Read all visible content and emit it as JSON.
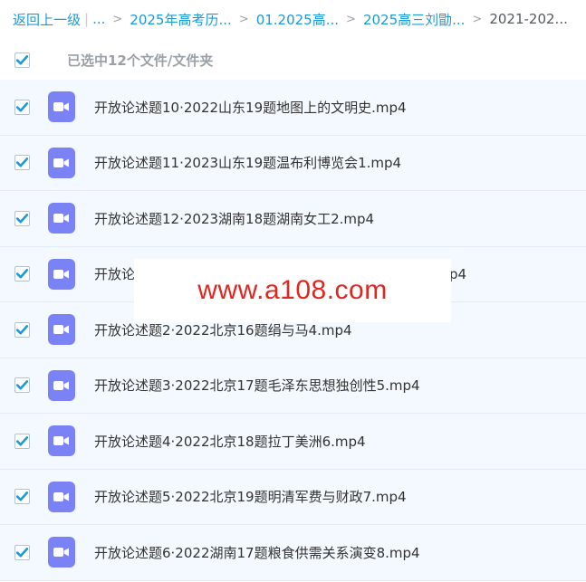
{
  "breadcrumb": {
    "back_label": "返回上一级",
    "pipe": "|",
    "ellipsis": "...",
    "separator": ">",
    "items": [
      "2025年高考历...",
      "01.2025高...",
      "2025高三刘勖...",
      "2021-202..."
    ]
  },
  "selection": {
    "summary": "已选中12个文件/文件夹",
    "all_checked": true
  },
  "files": [
    {
      "name": "开放论述题10·2022山东19题地图上的文明史.mp4",
      "checked": true,
      "icon": "video-file-icon"
    },
    {
      "name": "开放论述题11·2023山东19题温布利博览会1.mp4",
      "checked": true,
      "icon": "video-file-icon"
    },
    {
      "name": "开放论述题12·2023湖南18题湖南女工2.mp4",
      "checked": true,
      "icon": "video-file-icon"
    },
    {
      "name": "开放论",
      "name_tail": "p4",
      "checked": true,
      "icon": "video-file-icon"
    },
    {
      "name": "开放论述题2·2022北京16题绢与马4.mp4",
      "checked": true,
      "icon": "video-file-icon"
    },
    {
      "name": "开放论述题3·2022北京17题毛泽东思想独创性5.mp4",
      "checked": true,
      "icon": "video-file-icon"
    },
    {
      "name": "开放论述题4·2022北京18题拉丁美洲6.mp4",
      "checked": true,
      "icon": "video-file-icon"
    },
    {
      "name": "开放论述题5·2022北京19题明清军费与财政7.mp4",
      "checked": true,
      "icon": "video-file-icon"
    },
    {
      "name": "开放论述题6·2022湖南17题粮食供需关系演变8.mp4",
      "checked": true,
      "icon": "video-file-icon"
    }
  ],
  "watermark": {
    "text": "www.a108.com"
  },
  "colors": {
    "link": "#1a9bd6",
    "row_bg": "#f3f9fe",
    "checkbox_check": "#1a9bd6",
    "video_icon": "#7a82f5",
    "watermark_text": "#e2261e"
  }
}
